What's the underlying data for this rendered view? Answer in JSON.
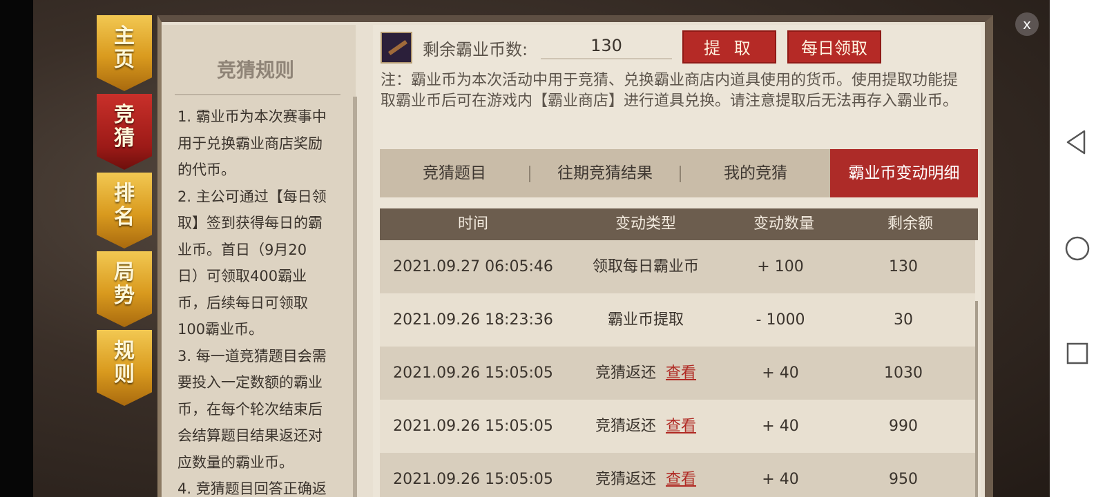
{
  "side_nav": [
    {
      "label": "主页",
      "c1": "主",
      "c2": "页",
      "active": false
    },
    {
      "label": "竞猜",
      "c1": "竞",
      "c2": "猜",
      "active": true
    },
    {
      "label": "排名",
      "c1": "排",
      "c2": "名",
      "active": false
    },
    {
      "label": "局势",
      "c1": "局",
      "c2": "势",
      "active": false
    },
    {
      "label": "规则",
      "c1": "规",
      "c2": "则",
      "active": false
    }
  ],
  "rules": {
    "title": "竞猜规则",
    "lines": [
      "1. 霸业币为本次赛事中",
      "用于兑换霸业商店奖励",
      "的代币。",
      "2. 主公可通过【每日领",
      "取】签到获得每日的霸",
      "业币。首日（9月20",
      "日）可领取400霸业",
      "币，后续每日可领取",
      "100霸业币。",
      "3. 每一道竞猜题目会需",
      "要投入一定数额的霸业",
      "币，在每个轮次结束后",
      "会结算题目结果返还对",
      "应数量的霸业币。",
      "4. 竞猜题目回答正确返"
    ]
  },
  "header": {
    "coin_label": "剩余霸业币数:",
    "coin_value": "130",
    "withdraw_button": "提 取",
    "daily_button": "每日领取",
    "item_icon": "sword-item-icon"
  },
  "note": "注：霸业币为本次活动中用于竞猜、兑换霸业商店内道具使用的货币。使用提取功能提取霸业币后可在游戏内【霸业商店】进行道具兑换。请注意提取后无法再存入霸业币。",
  "tabs": [
    {
      "label": "竞猜题目",
      "active": false
    },
    {
      "label": "往期竞猜结果",
      "active": false
    },
    {
      "label": "我的竞猜",
      "active": false
    },
    {
      "label": "霸业币变动明细",
      "active": true
    }
  ],
  "table": {
    "headers": [
      "时间",
      "变动类型",
      "变动数量",
      "剩余额"
    ],
    "view_label": "查看",
    "rows": [
      {
        "time": "2021.09.27 06:05:46",
        "type": "领取每日霸业币",
        "change": "+ 100",
        "balance": "130",
        "has_view": false
      },
      {
        "time": "2021.09.26 18:23:36",
        "type": "霸业币提取",
        "change": "- 1000",
        "balance": "30",
        "has_view": false
      },
      {
        "time": "2021.09.26 15:05:05",
        "type": "竞猜返还",
        "change": "+ 40",
        "balance": "1030",
        "has_view": true
      },
      {
        "time": "2021.09.26 15:05:05",
        "type": "竞猜返还",
        "change": "+ 40",
        "balance": "990",
        "has_view": true
      },
      {
        "time": "2021.09.26 15:05:05",
        "type": "竞猜返还",
        "change": "+ 40",
        "balance": "950",
        "has_view": true
      }
    ]
  },
  "close_label": "x",
  "colors": {
    "accent_red": "#b52a26",
    "gold": "#e0a72a",
    "header_brown": "#6c5d4e"
  }
}
